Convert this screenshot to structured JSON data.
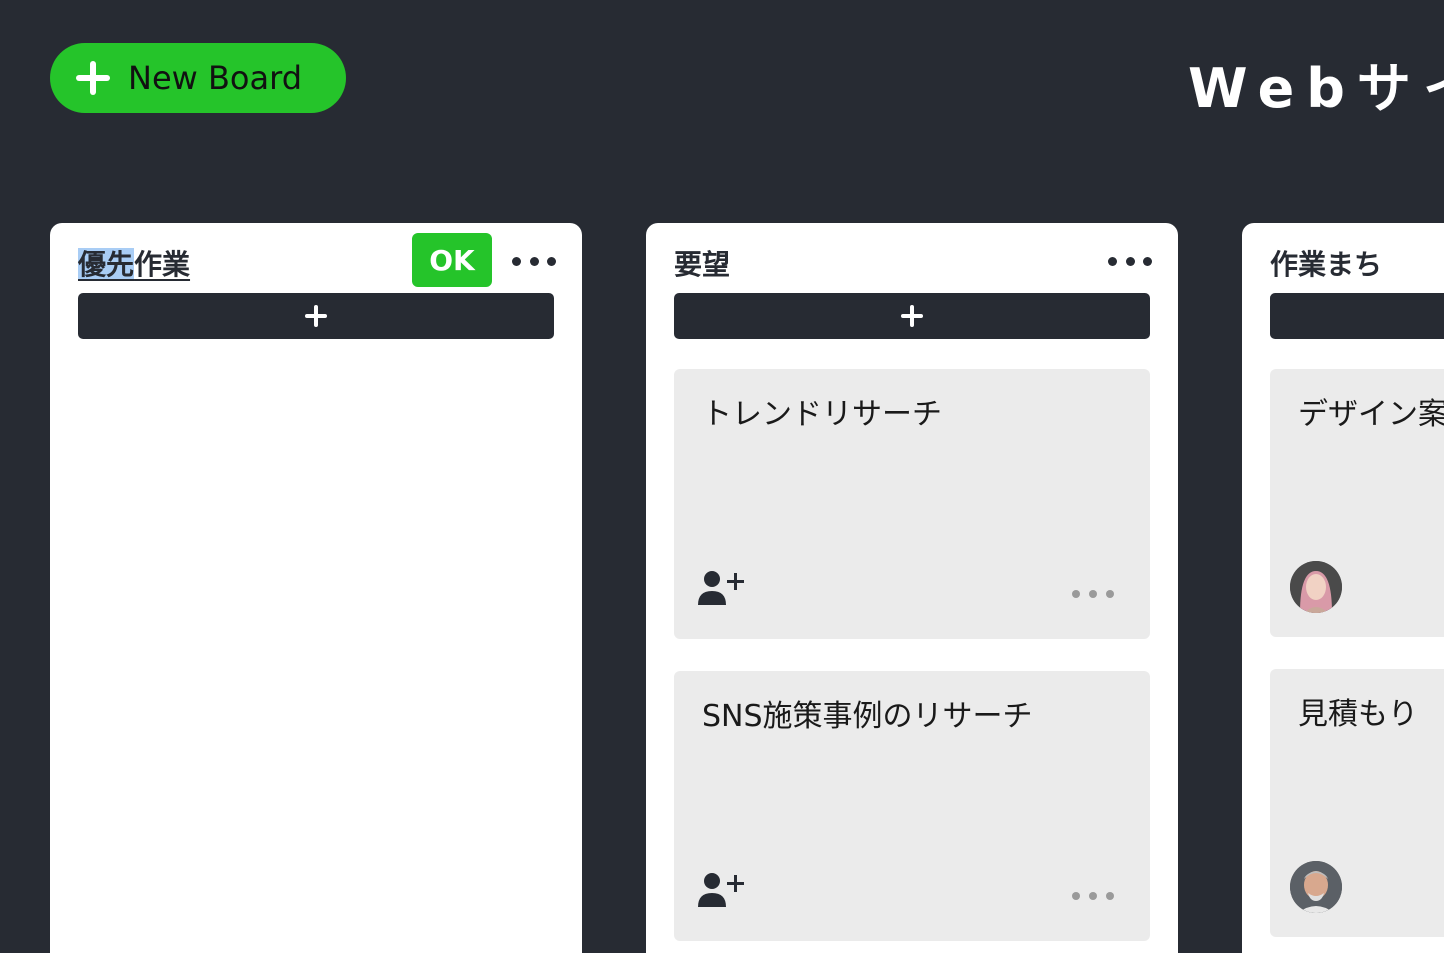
{
  "header": {
    "new_board_label": "New Board",
    "board_title": "Webサイ"
  },
  "columns": [
    {
      "title_selected": "優先",
      "title_rest": "作業",
      "ok_label": "OK",
      "cards": []
    },
    {
      "title": "要望",
      "cards": [
        {
          "title": "トレンドリサーチ",
          "assignee": "add-assignee"
        },
        {
          "title": "SNS施策事例のリサーチ",
          "assignee": "add-assignee"
        }
      ]
    },
    {
      "title": "作業まち",
      "cards": [
        {
          "title": "デザイン案",
          "assignee": "avatar-woman"
        },
        {
          "title": "見積もり",
          "assignee": "avatar-man"
        }
      ]
    }
  ],
  "colors": {
    "background": "#272b33",
    "accent_green": "#25c42a",
    "card_bg": "#ebebeb",
    "selection": "#a9cdf5"
  },
  "icons": [
    "plus-icon",
    "more-dots-icon",
    "add-user-icon"
  ]
}
